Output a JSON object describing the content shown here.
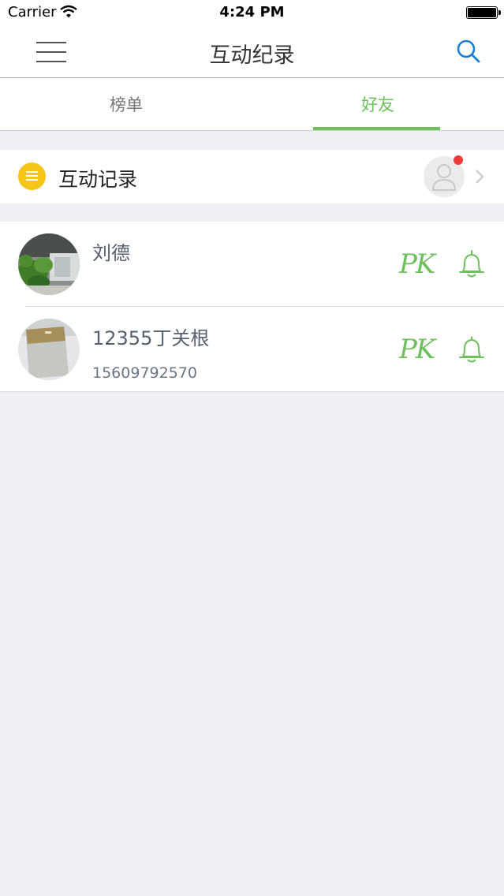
{
  "status_bar": {
    "carrier": "Carrier",
    "time": "4:24 PM"
  },
  "nav": {
    "title": "互动纪录"
  },
  "tabs": [
    {
      "label": "榜单",
      "selected": false
    },
    {
      "label": "好友",
      "selected": true
    }
  ],
  "record": {
    "label": "互动记录",
    "has_unread": true
  },
  "friends": [
    {
      "name": "刘德",
      "phone": "",
      "pk_label": "PK",
      "avatar": "photo-plants"
    },
    {
      "name": "12355丁关根",
      "phone": "15609792570",
      "pk_label": "PK",
      "avatar": "photo-device"
    }
  ],
  "colors": {
    "accent_green": "#6ec05c",
    "search_blue": "#1a7fd4",
    "note_yellow": "#f5c518",
    "unread_red": "#f03a3a",
    "background": "#efeff4"
  }
}
